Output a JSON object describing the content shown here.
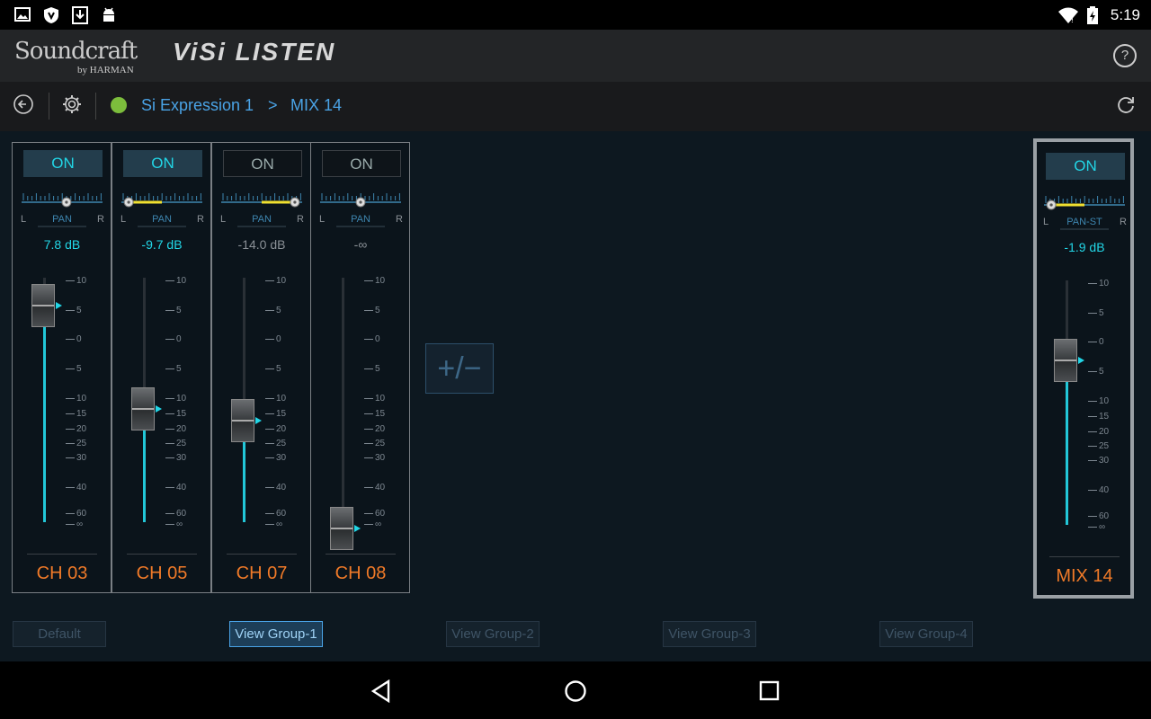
{
  "status_bar": {
    "time": "5:19"
  },
  "header": {
    "brand": "Soundcraft",
    "brand_sub": "by HARMAN",
    "product": "ViSi LISTEN"
  },
  "nav": {
    "device": "Si Expression 1",
    "separator": ">",
    "mix": "MIX 14"
  },
  "channels": [
    {
      "on_label": "ON",
      "on": true,
      "pan_label": "PAN",
      "pan_left": "L",
      "pan_right": "R",
      "pan": 0.56,
      "db": "7.8 dB",
      "level": 0.93,
      "label": "CH 03"
    },
    {
      "on_label": "ON",
      "on": true,
      "pan_label": "PAN",
      "pan_left": "L",
      "pan_right": "R",
      "pan": 0.05,
      "db": "-9.7 dB",
      "level": 0.5,
      "label": "CH 05"
    },
    {
      "on_label": "ON",
      "on": false,
      "pan_label": "PAN",
      "pan_left": "L",
      "pan_right": "R",
      "pan": 0.95,
      "db": "-14.0 dB",
      "level": 0.45,
      "label": "CH 07"
    },
    {
      "on_label": "ON",
      "on": false,
      "pan_label": "PAN",
      "pan_left": "L",
      "pan_right": "R",
      "pan": 0.5,
      "db": "-∞",
      "level": 0.0,
      "label": "CH 08"
    }
  ],
  "master": {
    "on_label": "ON",
    "on": true,
    "pan_label": "PAN-ST",
    "pan_left": "L",
    "pan_right": "R",
    "pan": 0.05,
    "db": "-1.9 dB",
    "level": 0.71,
    "label": "MIX 14"
  },
  "scale_labels": [
    "10",
    "5",
    "0",
    "5",
    "10",
    "15",
    "20",
    "25",
    "30",
    "40",
    "60",
    "∞"
  ],
  "plus_minus": "+/−",
  "view_groups": [
    {
      "label": "Default",
      "selected": false
    },
    {
      "label": "View Group-1",
      "selected": true
    },
    {
      "label": "View Group-2",
      "selected": false
    },
    {
      "label": "View Group-3",
      "selected": false
    },
    {
      "label": "View Group-4",
      "selected": false
    }
  ],
  "colors": {
    "accent": "#22d6e6",
    "channel_label": "#f07a28",
    "link": "#4aa3e6",
    "pan_highlight": "#f0e030",
    "status_dot": "#7cbd3c"
  }
}
